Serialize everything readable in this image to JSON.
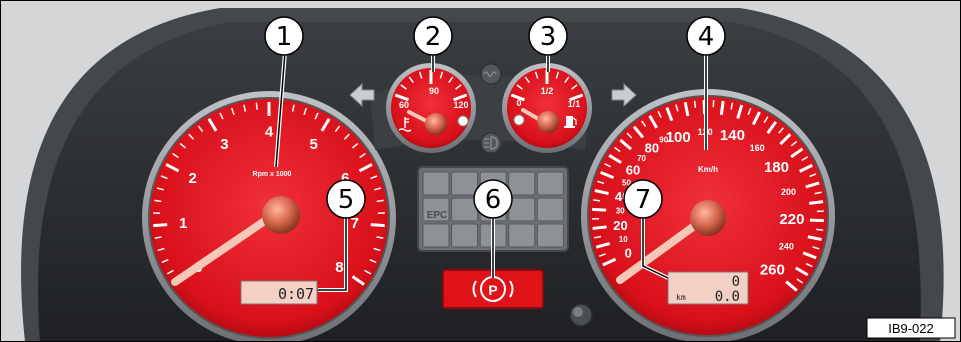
{
  "figure_code": "IB9-022",
  "callouts": [
    "1",
    "2",
    "3",
    "4",
    "5",
    "6",
    "7"
  ],
  "tachometer": {
    "unit_label": "Rpm x 1000",
    "scale": [
      "0",
      "1",
      "2",
      "3",
      "4",
      "5",
      "6",
      "7",
      "8"
    ],
    "lcd_value": "0:07"
  },
  "temp_gauge": {
    "scale": [
      "60",
      "90",
      "120"
    ]
  },
  "fuel_gauge": {
    "scale": [
      "0",
      "1/2",
      "1/1"
    ]
  },
  "speedometer": {
    "unit_label": "Km/h",
    "scale": [
      "0",
      "10",
      "20",
      "30",
      "40",
      "50",
      "60",
      "70",
      "80",
      "90",
      "100",
      "120",
      "140",
      "160",
      "180",
      "200",
      "220",
      "240",
      "260"
    ],
    "lcd_unit": "km",
    "lcd_total": "0",
    "lcd_trip": "0.0"
  },
  "warning_panel": {
    "labels": [
      "EPC"
    ]
  },
  "parking_brake": {
    "label": "P"
  },
  "icons": [
    "arrow-left-icon",
    "arrow-right-icon",
    "preglow-icon",
    "headlight-icon",
    "coolant-temp-icon",
    "fuel-pump-icon",
    "parking-brake-icon"
  ],
  "colors": {
    "dial_red": "#d8101a",
    "panel_dark": "#2a2d31",
    "brake_red": "#e01418"
  }
}
